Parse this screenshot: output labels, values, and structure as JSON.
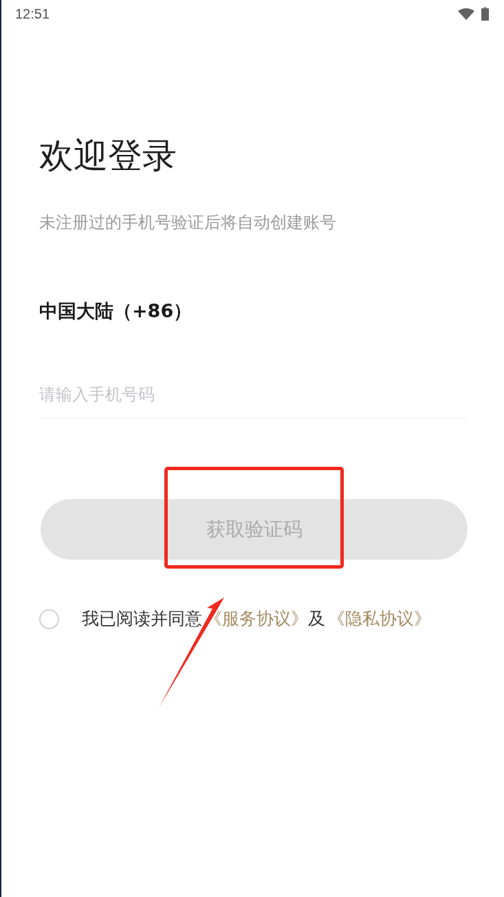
{
  "status_bar": {
    "time": "12:51"
  },
  "title": "欢迎登录",
  "subtitle": "未注册过的手机号验证后将自动创建账号",
  "region": "中国大陆（+86）",
  "phone_input": {
    "placeholder": "请输入手机号码"
  },
  "submit_button": {
    "label": "获取验证码",
    "disabled": true
  },
  "agreement": {
    "checked": false,
    "parts": [
      {
        "kind": "text",
        "text": "我已阅读并同意"
      },
      {
        "kind": "link",
        "text": "《服务协议》"
      },
      {
        "kind": "text",
        "text": "及"
      },
      {
        "kind": "link",
        "text": "《隐私协议》"
      }
    ]
  },
  "annotations": {
    "highlight_frame": true,
    "pointer_arrow": true
  }
}
